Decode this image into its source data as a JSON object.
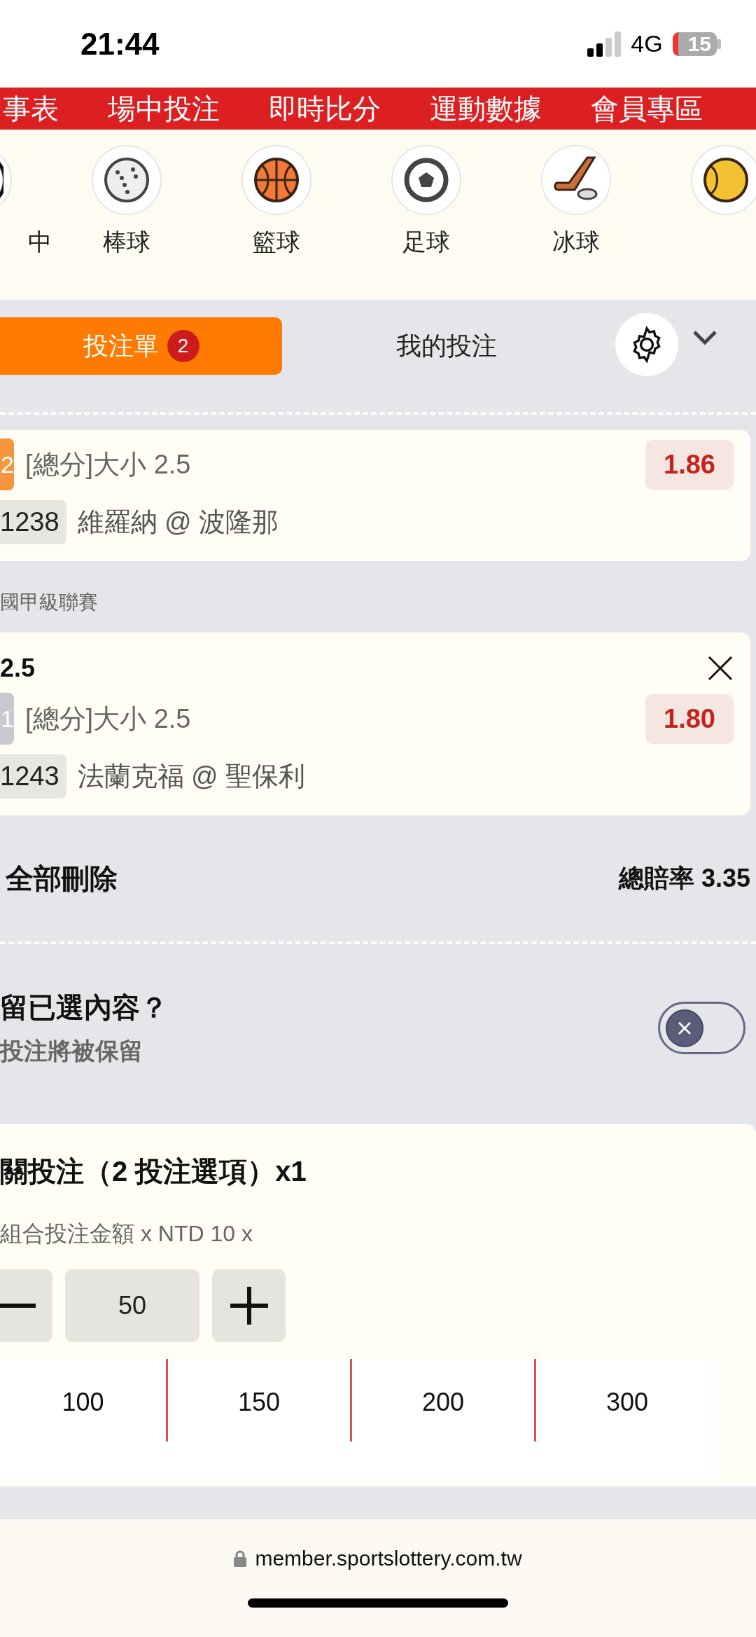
{
  "status_bar": {
    "time": "21:44",
    "network": "4G",
    "battery": "15"
  },
  "nav_links": [
    "事表",
    "場中投注",
    "即時比分",
    "運動數據",
    "會員專區"
  ],
  "sports": [
    {
      "kind": "live",
      "label": "中"
    },
    {
      "kind": "baseball",
      "label": "棒球"
    },
    {
      "kind": "basketball",
      "label": "籃球"
    },
    {
      "kind": "soccer",
      "label": "足球"
    },
    {
      "kind": "hockey",
      "label": "冰球"
    },
    {
      "kind": "tennis"
    }
  ],
  "tabs": [
    {
      "label": "投注單",
      "badge": "2",
      "selected": true
    },
    {
      "label": "我的投注",
      "selected": false
    }
  ],
  "bets": [
    {
      "index": "2",
      "color": "#f5953c",
      "market": "[總分]大小 2.5",
      "odds": "1.86",
      "code": "1238",
      "teams": "維羅納 @ 波隆那"
    },
    {
      "league": "國甲級聯賽",
      "title": "2.5",
      "index": "1",
      "color": "#c9c8d0",
      "market": "[總分]大小 2.5",
      "odds": "1.80",
      "code": "1243",
      "teams": "法蘭克福 @ 聖保利"
    }
  ],
  "summary": {
    "delete_all": "全部刪除",
    "total_label": "總賠率",
    "total": "3.35"
  },
  "keep": {
    "title": "留已選內容？",
    "subtitle": "投注將被保留",
    "on": false
  },
  "parlay": {
    "title": "關投注（2 投注選項）x1",
    "subtitle": "組合投注金額 x NTD 10 x",
    "stake": "50",
    "quick_amounts": [
      "100",
      "150",
      "200",
      "300"
    ]
  },
  "browser": {
    "url": "member.sportslottery.com.tw"
  }
}
